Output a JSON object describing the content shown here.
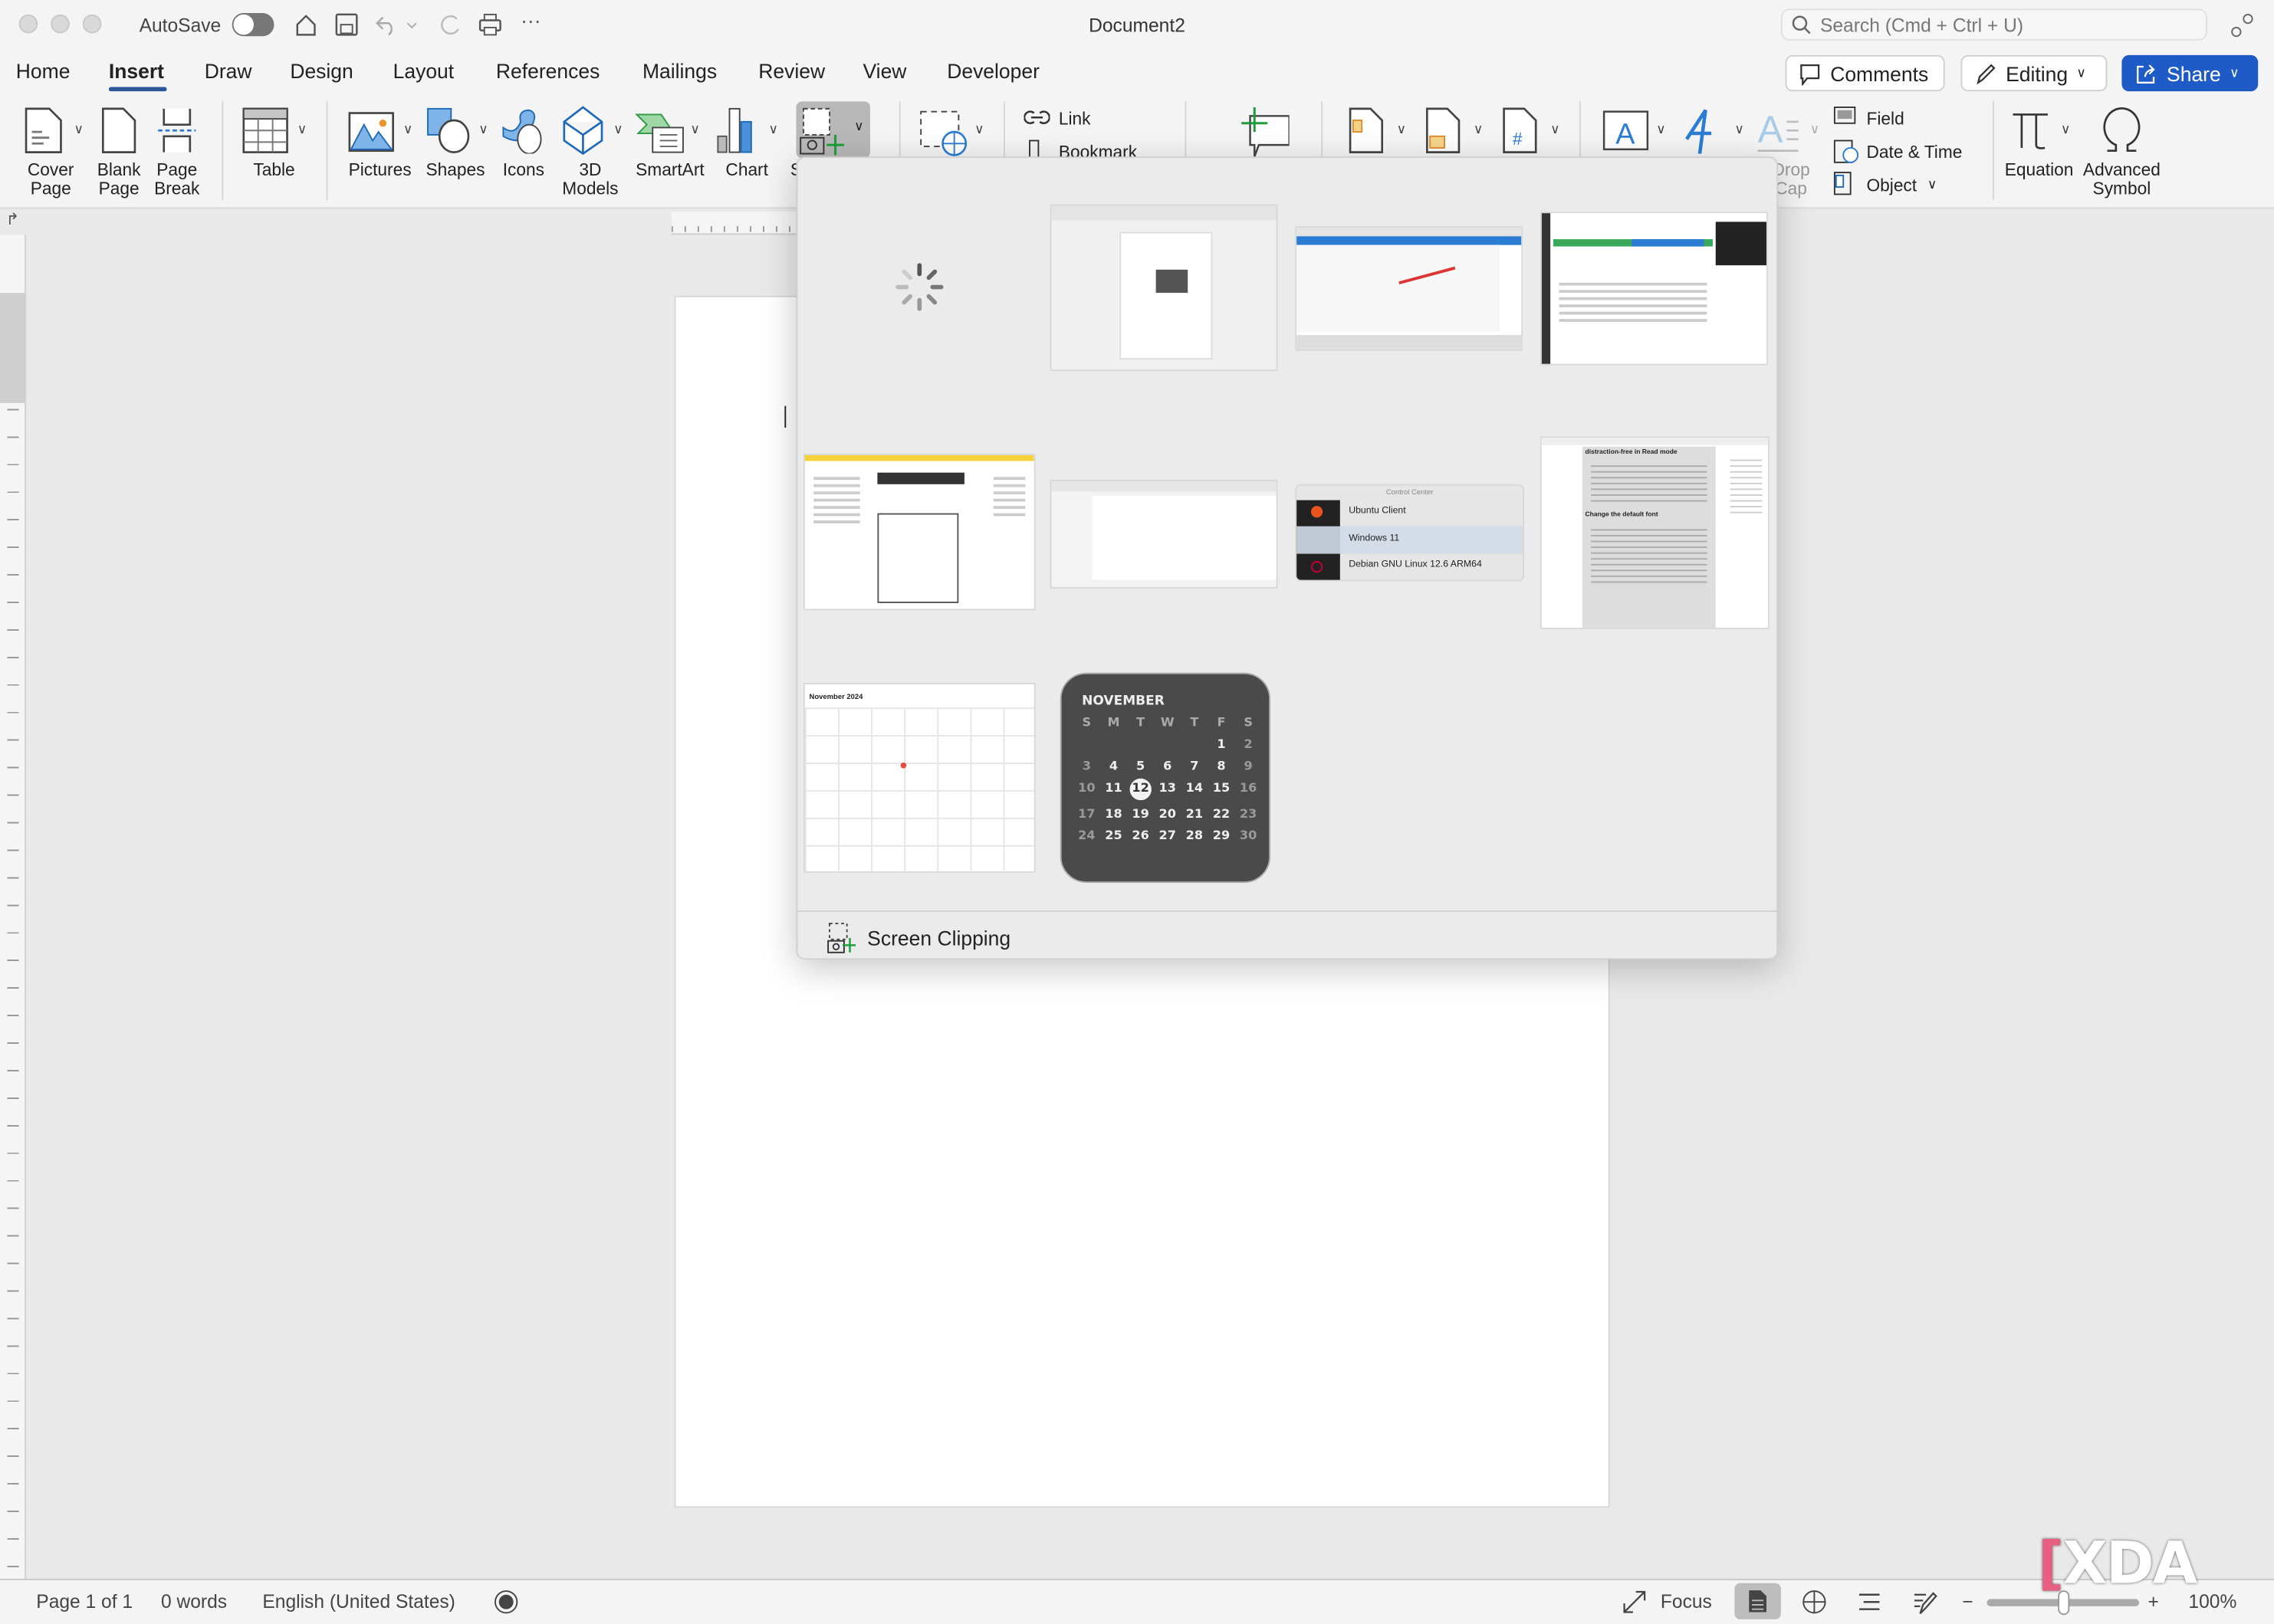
{
  "window": {
    "title": "Document2",
    "autosave_label": "AutoSave",
    "autosave_on": false
  },
  "search": {
    "placeholder": "Search (Cmd + Ctrl + U)"
  },
  "tabs": [
    {
      "label": "Home"
    },
    {
      "label": "Insert",
      "active": true
    },
    {
      "label": "Draw"
    },
    {
      "label": "Design"
    },
    {
      "label": "Layout"
    },
    {
      "label": "References"
    },
    {
      "label": "Mailings"
    },
    {
      "label": "Review"
    },
    {
      "label": "View"
    },
    {
      "label": "Developer"
    }
  ],
  "header_buttons": {
    "comments": "Comments",
    "editing": "Editing",
    "share": "Share"
  },
  "ribbon": {
    "cover_page": [
      "Cover",
      "Page"
    ],
    "blank_page": [
      "Blank",
      "Page"
    ],
    "page_break": [
      "Page",
      "Break"
    ],
    "table": "Table",
    "pictures": "Pictures",
    "shapes": "Shapes",
    "icons": "Icons",
    "models": [
      "3D",
      "Models"
    ],
    "smartart": "SmartArt",
    "chart": "Chart",
    "screenshot_partial": "S",
    "link": "Link",
    "bookmark": "Bookmark",
    "drop_cap": [
      "Drop",
      "Cap"
    ],
    "field": "Field",
    "date_time": "Date & Time",
    "object": "Object",
    "equation": "Equation",
    "advanced_symbol": [
      "Advanced",
      "Symbol"
    ]
  },
  "screenshot_menu": {
    "footer_label": "Screen Clipping",
    "control_center": {
      "title": "Control Center",
      "items": [
        "Ubuntu Client",
        "Windows 11",
        "Debian GNU Linux 12.6 ARM64"
      ],
      "selected": 1
    },
    "doc_thumb": {
      "headings": [
        "distraction-free in Read mode",
        "Change the default font"
      ]
    },
    "calendar_thumb": {
      "title": "November 2024"
    },
    "calendar_widget": {
      "month": "NOVEMBER",
      "weekdays": [
        "S",
        "M",
        "T",
        "W",
        "T",
        "F",
        "S"
      ],
      "weeks": [
        [
          "",
          "",
          "",
          "",
          "",
          "1",
          "2"
        ],
        [
          "3",
          "4",
          "5",
          "6",
          "7",
          "8",
          "9"
        ],
        [
          "10",
          "11",
          "12",
          "13",
          "14",
          "15",
          "16"
        ],
        [
          "17",
          "18",
          "19",
          "20",
          "21",
          "22",
          "23"
        ],
        [
          "24",
          "25",
          "26",
          "27",
          "28",
          "29",
          "30"
        ]
      ],
      "today": "12"
    }
  },
  "status": {
    "page": "Page 1 of 1",
    "words": "0 words",
    "language": "English (United States)",
    "focus": "Focus",
    "zoom": "100%",
    "zoom_percent": 100
  },
  "watermark": "XDA",
  "colors": {
    "accent": "#1e5bc6",
    "tab_underline": "#2b579a"
  }
}
